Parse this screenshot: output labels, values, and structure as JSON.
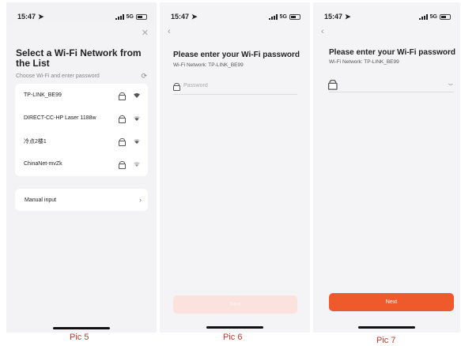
{
  "status": {
    "time": "15:47",
    "network": "5G"
  },
  "pic5": {
    "title": "Select a Wi-Fi Network from the List",
    "subtitle": "Choose Wi-Fi and enter password",
    "networks": [
      {
        "name": "TP-LINK_BE99"
      },
      {
        "name": "DIRECT-CC-HP Laser 1188w"
      },
      {
        "name": "冷点2楼1"
      },
      {
        "name": "ChinaNet-mvZk"
      }
    ],
    "manual_label": "Manual input",
    "caption": "Pic 5"
  },
  "pic6": {
    "title": "Please enter your Wi-Fi password",
    "network_line": "Wi-Fi Network: TP-LINK_BE99",
    "password_placeholder": "Password",
    "next_label": "Next",
    "caption": "Pic 6"
  },
  "pic7": {
    "title": "Please enter your Wi-Fi password",
    "network_line": "Wi-Fi Network: TP-LINK_BE99",
    "password_value": "",
    "next_label": "Next",
    "caption": "Pic 7"
  },
  "colors": {
    "accent": "#ef5a2d",
    "accent_disabled": "#fbe2dc",
    "caption": "#c0392b"
  },
  "icons": [
    "location-arrow-icon",
    "signal-icon",
    "battery-icon",
    "close-icon",
    "refresh-icon",
    "lock-icon",
    "wifi-icon",
    "chevron-right-icon",
    "back-icon",
    "chevron-down-icon"
  ]
}
